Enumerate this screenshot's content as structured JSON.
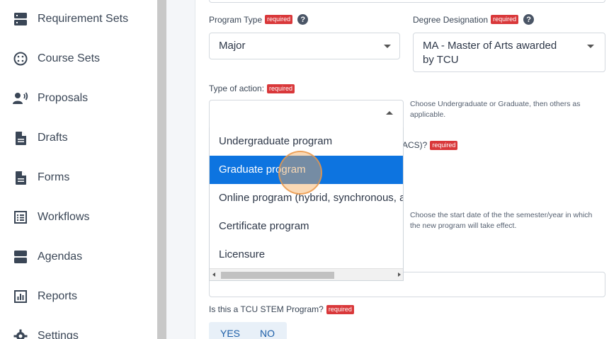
{
  "sidebar": {
    "items": [
      {
        "label": "Requirement Sets",
        "icon": "requirement-sets-icon"
      },
      {
        "label": "Course Sets",
        "icon": "course-sets-icon"
      },
      {
        "label": "Proposals",
        "icon": "proposals-icon"
      },
      {
        "label": "Drafts",
        "icon": "document-icon"
      },
      {
        "label": "Forms",
        "icon": "document-icon"
      },
      {
        "label": "Workflows",
        "icon": "workflows-icon"
      },
      {
        "label": "Agendas",
        "icon": "agendas-icon"
      },
      {
        "label": "Reports",
        "icon": "reports-icon"
      },
      {
        "label": "Settings",
        "icon": "gear-icon"
      }
    ]
  },
  "form": {
    "required_badge": "required",
    "help_glyph": "?",
    "program_type": {
      "label": "Program Type",
      "value": "Major"
    },
    "degree_designation": {
      "label": "Degree Designation",
      "value_line1": "MA - Master of Arts awarded",
      "value_line2": "by TCU"
    },
    "type_of_action": {
      "label": "Type of action:",
      "value": "",
      "hint_line1": "Choose Undergraduate or Graduate, then others as",
      "hint_line2": "applicable.",
      "options": [
        "Undergraduate program",
        "Graduate program",
        "Online program (hybrid, synchronous, asynchronous)",
        "Certificate program",
        "Licensure"
      ],
      "selected_index": 1
    },
    "partial_label": "ACS)?",
    "start_date_hint_line1": "Choose the start date of the the semester/year in which",
    "start_date_hint_line2": "the new program will take effect.",
    "stem": {
      "label": "Is this a TCU STEM Program?",
      "yes": "YES",
      "no": "NO"
    }
  },
  "colors": {
    "selected_option": "#0d74e0",
    "required_badge": "#d9383a",
    "toggle_text": "#1e5fa8"
  }
}
